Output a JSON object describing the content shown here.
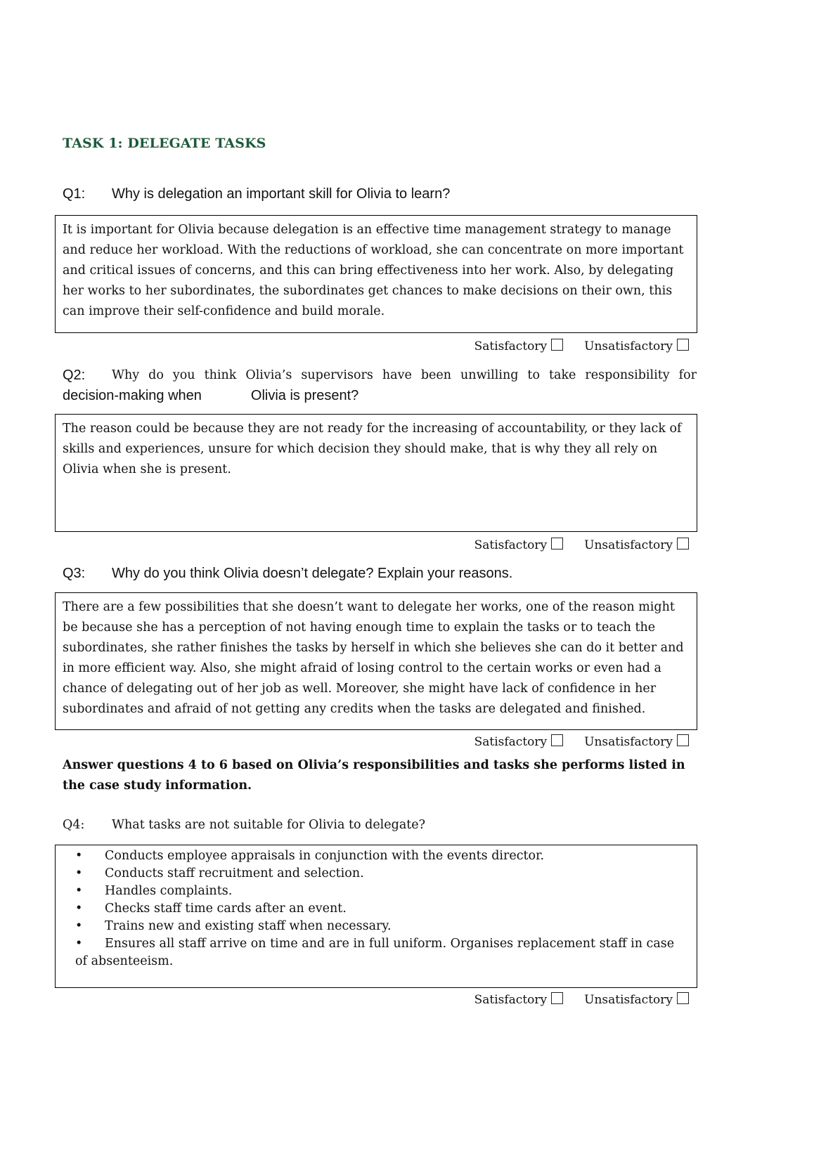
{
  "task": {
    "title": "TASK 1: DELEGATE TASKS"
  },
  "rating": {
    "satisfactory_label": "Satisfactory",
    "unsatisfactory_label": "Unsatisfactory"
  },
  "questions": [
    {
      "number": "Q1:",
      "text": "Why is delegation an important skill for Olivia to learn?",
      "answer": "It is important for Olivia because delegation is an effective time management strategy to manage and reduce her workload. With the reductions of workload, she can concentrate on more important and critical issues of concerns, and this can bring effectiveness into her work. Also, by delegating her works to her subordinates, the subordinates get chances to make decisions on their own, this can improve their self-confidence and build morale."
    },
    {
      "number": "Q2:",
      "text_line1": "Why do you think Olivia’s supervisors have been unwilling to take responsibility for",
      "text_line2a": "decision-making when",
      "text_line2b": "Olivia is present?",
      "answer": "The reason could be because they are not ready for the increasing of accountability, or they lack of skills and experiences, unsure for which decision they should make, that is why they all rely on Olivia when she is present."
    },
    {
      "number": "Q3:",
      "text": "Why do you think Olivia doesn’t delegate? Explain your reasons.",
      "answer": "There are a few possibilities that she doesn’t want to delegate her works, one of the reason might be because she has a perception of not having enough time to explain the tasks or to teach the subordinates, she rather finishes the tasks by herself in which she believes she can do it better and in more efficient way. Also, she might afraid of losing control to the certain works or even had a chance of delegating out of her job as well. Moreover, she might have lack of confidence in her subordinates and afraid of not getting any credits when the tasks are delegated and finished."
    },
    {
      "number": "Q4:",
      "text": "What tasks are not suitable for Olivia to delegate?",
      "bullet_symbol": "•",
      "answer_items": [
        "Conducts employee appraisals in conjunction with the events director.",
        "Conducts staff recruitment and selection.",
        "Handles complaints.",
        "Checks staff time cards after an event.",
        "Trains new and existing staff when necessary.",
        "Ensures all staff arrive on time and are in full uniform. Organises replacement staff in case of absenteeism."
      ]
    }
  ],
  "instruction": "Answer questions 4 to 6 based on Olivia’s responsibilities and tasks she performs listed in the case study information."
}
